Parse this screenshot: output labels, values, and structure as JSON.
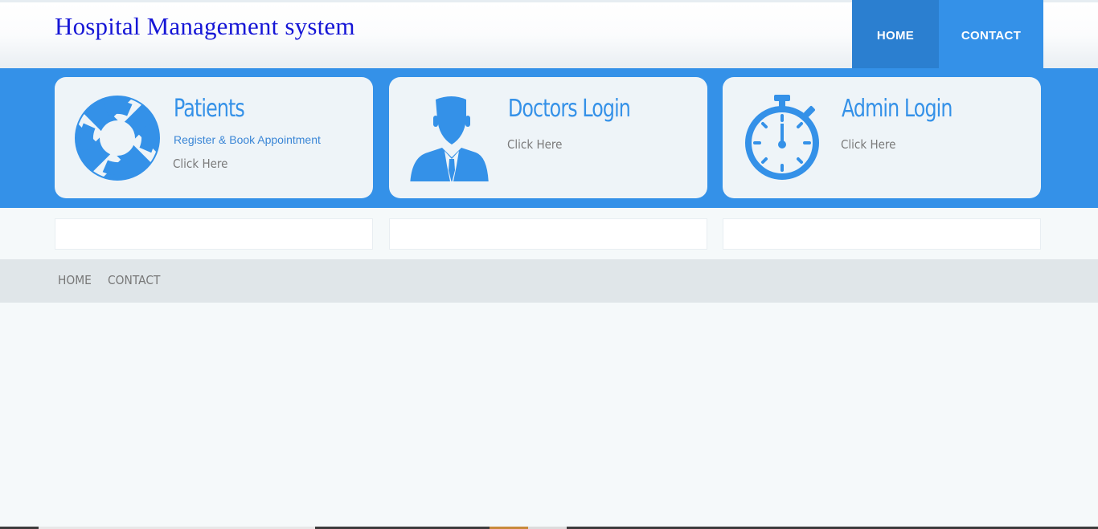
{
  "header": {
    "title": "Hospital Management system",
    "nav": {
      "home": "HOME",
      "contact": "CONTACT"
    }
  },
  "cards": [
    {
      "title": "Patients",
      "subtitle": "Register & Book Appointment",
      "link": "Click Here",
      "icon": "lifebuoy-icon"
    },
    {
      "title": "Doctors Login",
      "link": "Click Here",
      "icon": "doctor-icon"
    },
    {
      "title": "Admin Login",
      "link": "Click Here",
      "icon": "stopwatch-icon"
    }
  ],
  "footer": {
    "nav": {
      "home": "HOME",
      "contact": "CONTACT"
    }
  },
  "colors": {
    "accent": "#3491e8",
    "accent_dark": "#2b7fd0",
    "title_blue": "#1616d6",
    "footer_bg": "#e0e6e9"
  }
}
